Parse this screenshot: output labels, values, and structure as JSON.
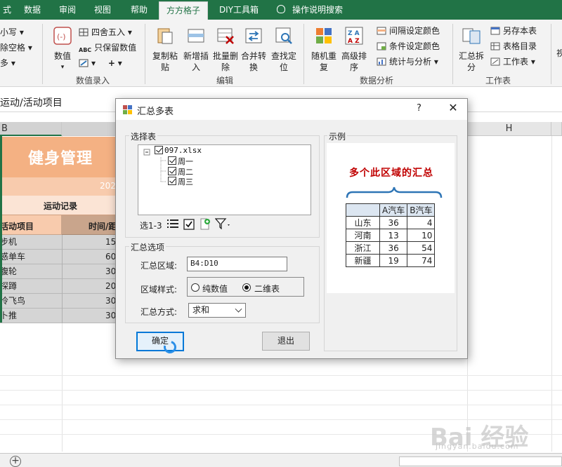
{
  "ribbon_tabs": [
    "式",
    "数据",
    "审阅",
    "视图",
    "帮助",
    "方方格子",
    "DIY工具箱",
    "操作说明搜索"
  ],
  "active_tab": "方方格子",
  "ribbon": {
    "left_items": [
      "小写",
      "除空格",
      "多"
    ],
    "value_input_group": {
      "label": "数值录入",
      "numeric_button": "数值",
      "round_label": "四舍五入",
      "keep_numbers_label": "只保留数值",
      "plus": "+"
    },
    "edit_group": {
      "label": "编辑",
      "buttons": [
        {
          "top": "复制粘",
          "bottom": "贴"
        },
        {
          "top": "新增插",
          "bottom": "入"
        },
        {
          "top": "批量删",
          "bottom": "除"
        },
        {
          "top": "合并转",
          "bottom": "换"
        },
        {
          "top": "查找定",
          "bottom": "位"
        }
      ]
    },
    "analysis_group": {
      "label": "数据分析",
      "buttons": [
        {
          "top": "随机重",
          "bottom": "复"
        },
        {
          "top": "高级排",
          "bottom": "序"
        }
      ],
      "small_items": [
        "间隔设定颜色",
        "条件设定颜色",
        "统计与分析"
      ]
    },
    "worksheet_group": {
      "label": "工作表",
      "split_button": {
        "top": "汇总拆",
        "bottom": "分"
      },
      "small_items": [
        "另存本表",
        "表格目录",
        "工作表"
      ],
      "overflow": "视"
    }
  },
  "formula_bar": {
    "text": "运动/活动项目"
  },
  "sheet": {
    "columns": [
      "B",
      "H"
    ],
    "title": "健身管理",
    "year_partial": "202",
    "record_label": "运动记录",
    "header_item": "活动项目",
    "header_time": "时间/距",
    "rows": [
      {
        "item": "步机",
        "value": "15"
      },
      {
        "item": "惑单车",
        "value": "60"
      },
      {
        "item": "腹轮",
        "value": "30"
      },
      {
        "item": "探蹲",
        "value": "20"
      },
      {
        "item": "冷飞鸟",
        "value": "30"
      },
      {
        "item": "卜推",
        "value": "30"
      }
    ]
  },
  "dialog": {
    "title": "汇总多表",
    "help": "?",
    "close": "✕",
    "select_table_legend": "选择表",
    "tree": {
      "file": "097.xlsx",
      "sheets": [
        "周一",
        "周二",
        "周三"
      ]
    },
    "selection_count": "选1-3",
    "options_legend": "汇总选项",
    "range_label": "汇总区域:",
    "range_value": "B4:D10",
    "style_label": "区域样式:",
    "style_options": [
      "纯数值",
      "二维表"
    ],
    "style_selected": "二维表",
    "method_label": "汇总方式:",
    "method_value": "求和",
    "ok_button": "确定",
    "exit_button": "退出",
    "example_legend": "示例",
    "example_heading": "多个此区域的汇总",
    "example_table": {
      "columns": [
        "A汽车",
        "B汽车"
      ],
      "rows": [
        {
          "name": "山东",
          "a": "36",
          "b": "4"
        },
        {
          "name": "河南",
          "a": "13",
          "b": "10"
        },
        {
          "name": "浙江",
          "a": "36",
          "b": "54"
        },
        {
          "name": "新疆",
          "a": "19",
          "b": "74"
        }
      ]
    }
  },
  "watermark": {
    "main": "Bai 经验",
    "sub": "jingyan.baidu.com"
  },
  "colors": {
    "excel_green": "#217346",
    "title_orange": "#f4b183",
    "example_red": "#c00000",
    "header_blue": "#dce6f1"
  }
}
